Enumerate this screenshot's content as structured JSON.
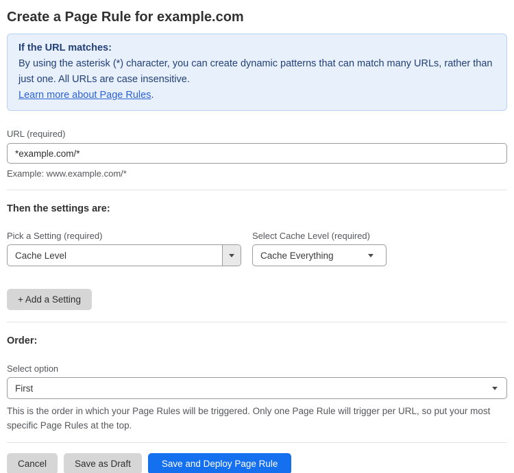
{
  "page": {
    "title": "Create a Page Rule for example.com"
  },
  "info_box": {
    "heading": "If the URL matches:",
    "body": "By using the asterisk (*) character, you can create dynamic patterns that can match many URLs, rather than just one. All URLs are case insensitive.",
    "link_label": "Learn more about Page Rules",
    "link_suffix": "."
  },
  "url_field": {
    "label": "URL (required)",
    "value": "*example.com/*",
    "helper": "Example: www.example.com/*"
  },
  "settings": {
    "heading": "Then the settings are:",
    "setting_picker": {
      "label": "Pick a Setting (required)",
      "value": "Cache Level"
    },
    "cache_level_picker": {
      "label": "Select Cache Level (required)",
      "value": "Cache Everything"
    },
    "add_setting_label": "+ Add a Setting"
  },
  "order": {
    "heading": "Order:",
    "label": "Select option",
    "value": "First",
    "helper": "This is the order in which your Page Rules will be triggered. Only one Page Rule will trigger per URL, so put your most specific Page Rules at the top."
  },
  "actions": {
    "cancel": "Cancel",
    "save_draft": "Save as Draft",
    "save_deploy": "Save and Deploy Page Rule"
  },
  "icons": {
    "dropdown_arrow": "caret-down"
  },
  "colors": {
    "primary_blue": "#1570ef",
    "info_bg": "#e7f0fb",
    "info_border": "#b9d3f3",
    "info_text": "#223f77",
    "link": "#2c62d1",
    "button_gray": "#d6d6d6",
    "input_border": "#9a9a9a",
    "divider": "#e4e4e4"
  }
}
